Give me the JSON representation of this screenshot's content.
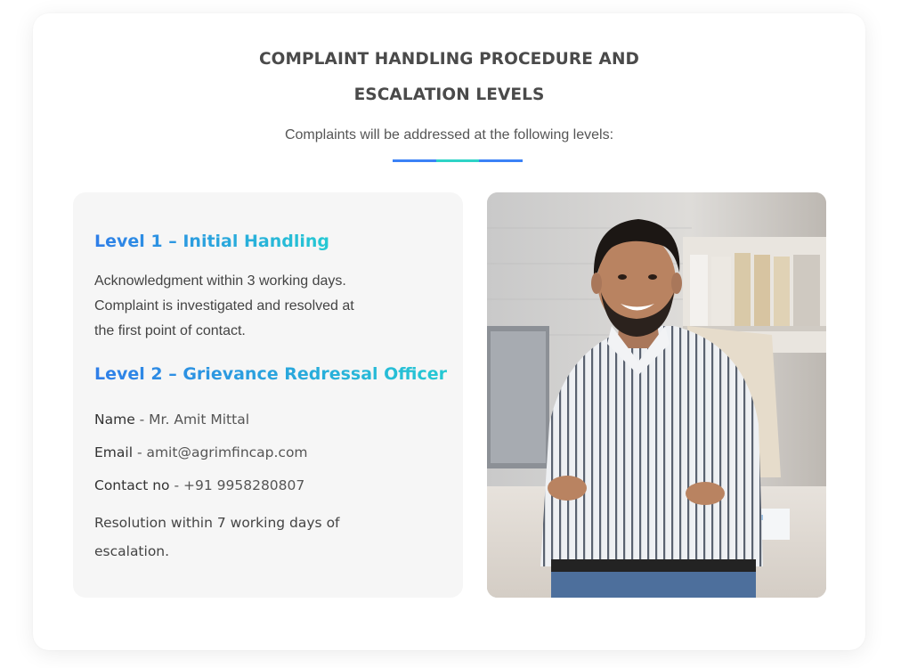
{
  "header": {
    "title_line1": "COMPLAINT HANDLING PROCEDURE AND",
    "title_line2": "ESCALATION LEVELS",
    "subtitle": "Complaints will be addressed at the following levels:"
  },
  "colors": {
    "accent_blue": "#3b82f6",
    "accent_teal": "#2ed3c6",
    "panel_bg": "#f6f6f6"
  },
  "level1": {
    "heading": "Level 1 – Initial Handling",
    "line1": "Acknowledgment within 3 working days.",
    "line2": "Complaint is investigated and resolved at",
    "line3": "the first point of contact."
  },
  "level2": {
    "heading": "Level 2 – Grievance Redressal Officer",
    "name_label": "Name",
    "name_value": " - Mr. Amit Mittal",
    "email_label": "Email",
    "email_value": " - amit@agrimfincap.com",
    "contact_label": "Contact no",
    "contact_value": " - +91 9958280807",
    "resolution": "Resolution within 7 working days of escalation."
  },
  "photo": {
    "icon": "officer-portrait-photo"
  }
}
